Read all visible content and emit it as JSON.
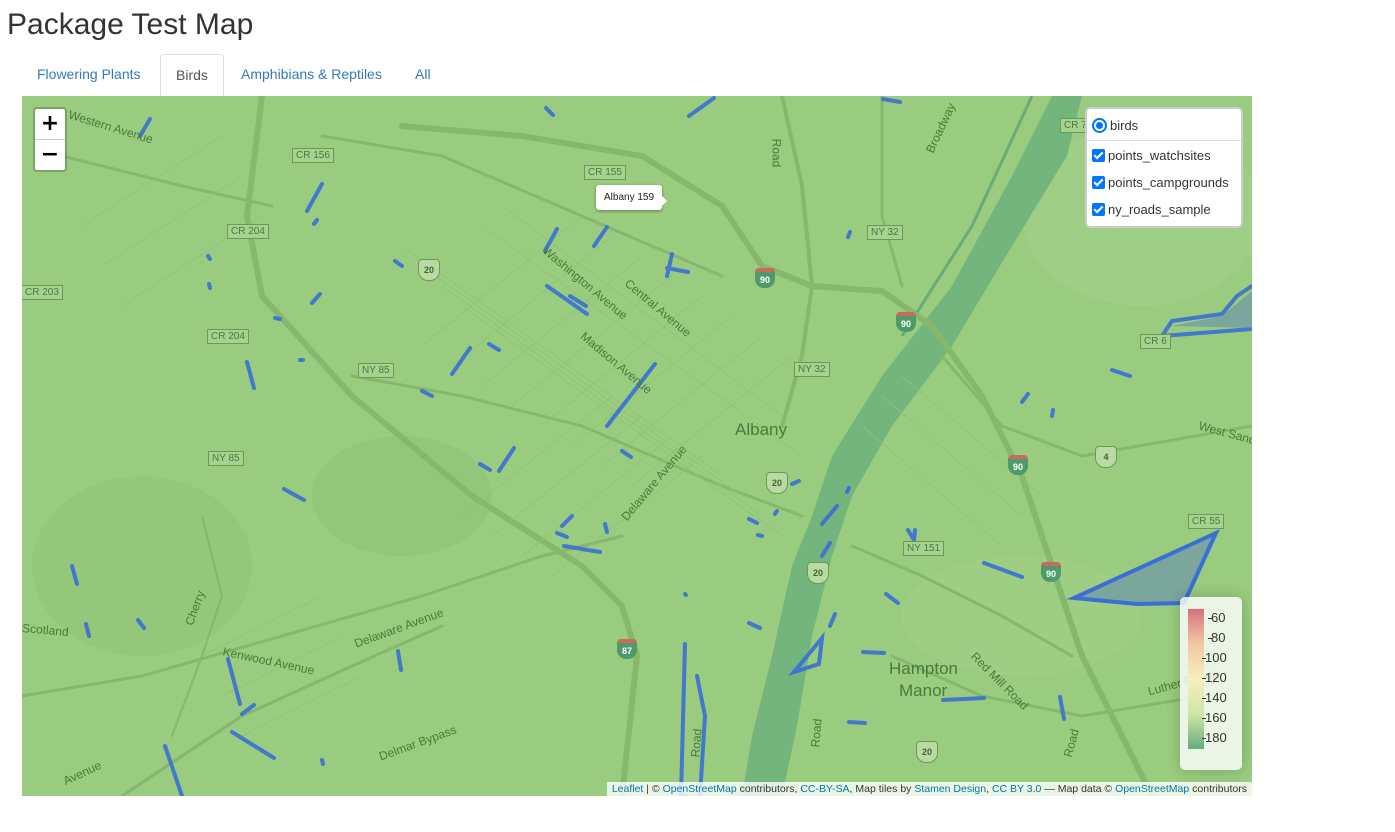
{
  "page": {
    "title": "Package Test Map"
  },
  "tabs": [
    {
      "label": "Flowering Plants",
      "active": false
    },
    {
      "label": "Birds",
      "active": true
    },
    {
      "label": "Amphibians & Reptiles",
      "active": false
    },
    {
      "label": "All",
      "active": false
    }
  ],
  "map": {
    "zoom_in": "+",
    "zoom_out": "−",
    "tooltip": "Albany 159",
    "layers": {
      "base": "birds",
      "overlays": [
        "points_watchsites",
        "points_campgrounds",
        "ny_roads_sample"
      ]
    },
    "legend": {
      "ticks": [
        "60",
        "80",
        "100",
        "120",
        "140",
        "160",
        "180"
      ]
    },
    "labels": {
      "city": "Albany",
      "hampton": "Hampton",
      "manor": "Manor",
      "streets": [
        "Western Avenue",
        "Washington Avenue",
        "Central Avenue",
        "Madison Avenue",
        "Delaware Avenue",
        "Delaware Avenue",
        "Kenwood Avenue",
        "Delmar Bypass",
        "Scotland",
        "Cherry",
        "Red Mill Road",
        "Luther Road",
        "West Sand",
        "Broadway",
        "Road",
        "Road",
        "Road",
        "Road",
        "Avenue"
      ],
      "shields": [
        "CR 156",
        "CR 155",
        "CR 204",
        "CR 203",
        "CR 204",
        "NY 85",
        "NY 85",
        "NY 32",
        "NY 32",
        "NY 151",
        "CR 55",
        "CR 7",
        "CR 6"
      ],
      "interstates": [
        "90",
        "90",
        "90",
        "90",
        "87"
      ],
      "us_routes": [
        "20",
        "20",
        "20",
        "20",
        "4"
      ]
    },
    "colors": {
      "roads": "#3a6fd6",
      "land": "#99cc7f"
    },
    "attribution": {
      "leaflet": "Leaflet",
      "sep": " | © ",
      "osm": "OpenStreetMap",
      "t1": " contributors, ",
      "ccbysa": "CC-BY-SA",
      "t2": ", Map tiles by ",
      "stamen": "Stamen Design",
      "t3": ", ",
      "ccby": "CC BY 3.0",
      "t4": " — Map data © ",
      "osm2": "OpenStreetMap",
      "t5": " contributors"
    }
  }
}
